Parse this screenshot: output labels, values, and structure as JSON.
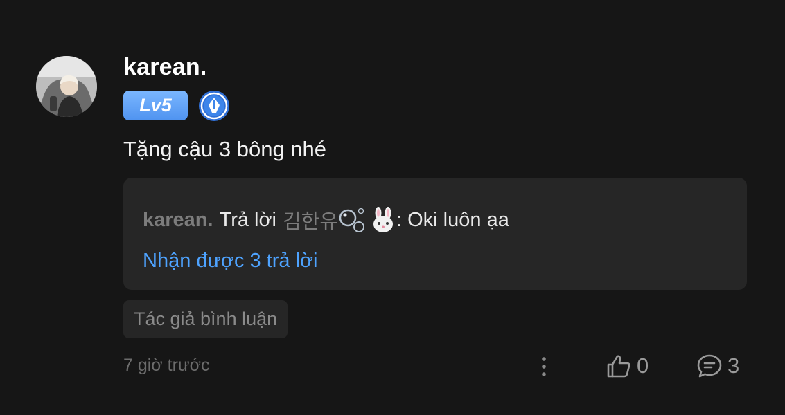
{
  "comment": {
    "username": "karean.",
    "level_badge": "Lv5",
    "role_badge_icon": "pen-nib-icon",
    "text": "Tặng cậu 3 bông nhé",
    "author_tag": "Tác giả bình luận",
    "timestamp": "7 giờ trước",
    "likes": "0",
    "replies": "3"
  },
  "reply_preview": {
    "author": "karean.",
    "connector": "Trả lời",
    "target_user": "김한유",
    "target_emojis": [
      "bubbles-emoji",
      "rabbit-emoji"
    ],
    "message": ": Oki luôn ạa",
    "more_replies_label": "Nhận được 3 trả lời"
  },
  "colors": {
    "background": "#161616",
    "panel": "#262626",
    "link": "#4ea3ff",
    "level_badge": "#5a9ff5",
    "muted": "#7c7c7c"
  }
}
